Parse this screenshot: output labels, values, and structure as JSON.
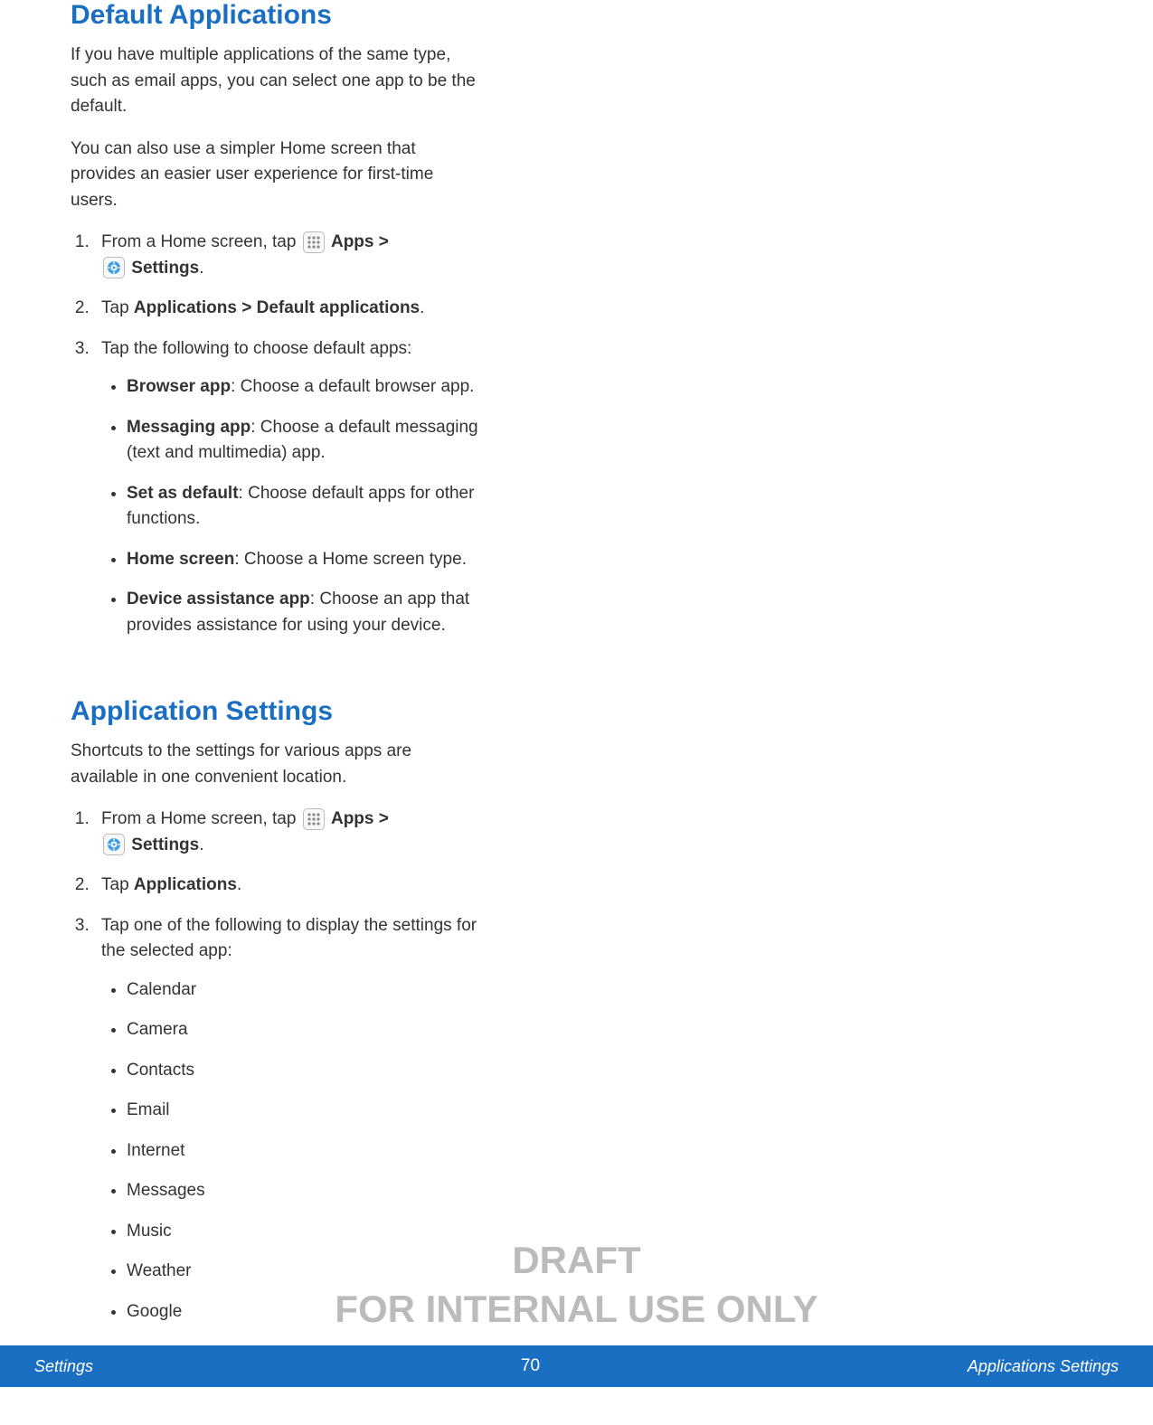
{
  "section1": {
    "title": "Default Applications",
    "intro1": "If you have multiple applications of the same type, such as email apps, you can select one app to be the default.",
    "intro2": "You can also use a simpler Home screen that provides an easier user experience for first-time users.",
    "step1_prefix": "From a Home screen, tap ",
    "step1_apps": "Apps",
    "step1_gt": " > ",
    "step1_settings": "Settings",
    "step1_period": ".",
    "step2_prefix": "Tap ",
    "step2_b1": "Applications",
    "step2_gt": " > ",
    "step2_b2": "Default applications",
    "step2_period": ".",
    "step3": "Tap the following to choose default apps:",
    "bullets": [
      {
        "label": "Browser app",
        "text": ": Choose a default browser app."
      },
      {
        "label": "Messaging app",
        "text": ": Choose a default messaging (text and multimedia) app."
      },
      {
        "label": "Set as default",
        "text": ": Choose default apps for other functions."
      },
      {
        "label": "Home screen",
        "text": ": Choose a Home screen type."
      },
      {
        "label": "Device assistance app",
        "text": ": Choose an app that provides assistance for using your device."
      }
    ]
  },
  "section2": {
    "title": "Application Settings",
    "intro": "Shortcuts to the settings for various apps are available in one convenient location.",
    "step1_prefix": "From a Home screen, tap ",
    "step1_apps": "Apps",
    "step1_gt": " > ",
    "step1_settings": "Settings",
    "step1_period": ".",
    "step2_prefix": "Tap ",
    "step2_b1": "Applications",
    "step2_period": ".",
    "step3": "Tap one of the following to display the settings for the selected app:",
    "apps": [
      "Calendar",
      "Camera",
      "Contacts",
      "Email",
      "Internet",
      "Messages",
      "Music",
      "Weather",
      "Google"
    ]
  },
  "watermark": {
    "line1": "DRAFT",
    "line2": "FOR INTERNAL USE ONLY"
  },
  "footer": {
    "left": "Settings",
    "center": "70",
    "right": "Applications Settings"
  }
}
